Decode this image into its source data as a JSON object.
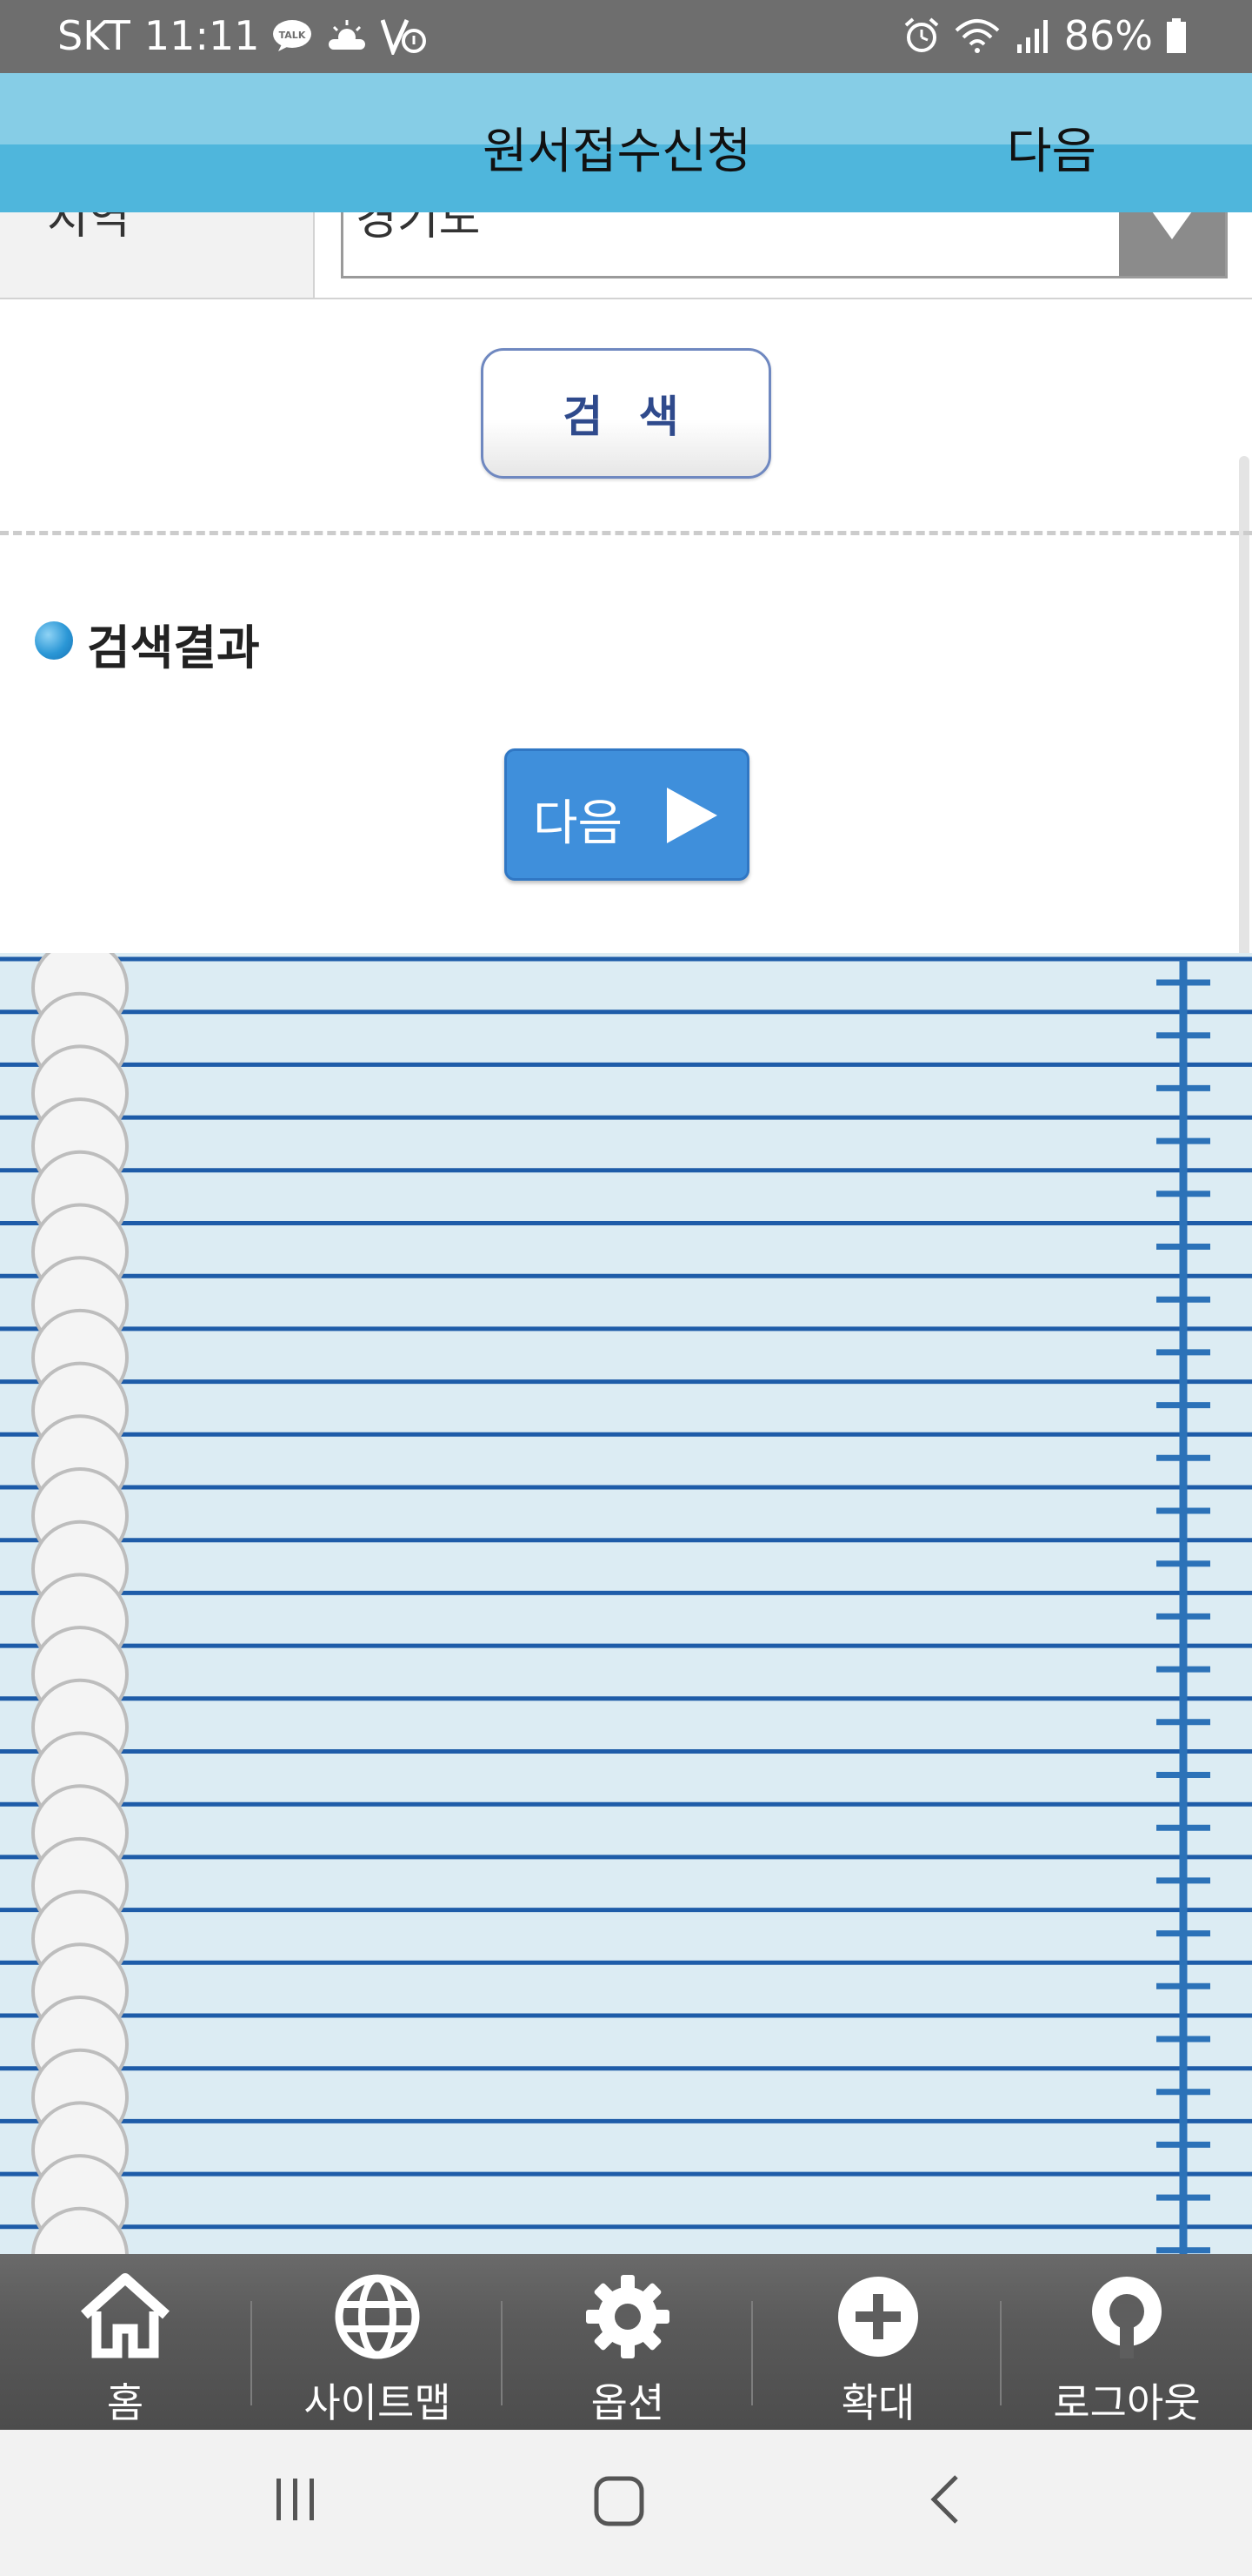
{
  "status_bar": {
    "carrier": "SKT",
    "time": "11:11",
    "battery_percent": "86%",
    "icons_left": [
      "kakaotalk-icon",
      "weather-icon",
      "v-notification-icon"
    ],
    "icons_right": [
      "alarm-icon",
      "wifi-icon",
      "signal-icon",
      "battery-icon"
    ]
  },
  "header": {
    "title": "원서접수신청",
    "next_label": "다음"
  },
  "search_form": {
    "region_label": "지역",
    "region_value": "경기도",
    "search_button_label": "검 색"
  },
  "results": {
    "title": "검색결과",
    "next_button_label": "다음"
  },
  "bottom_nav": {
    "items": [
      {
        "label": "홈",
        "icon": "home-icon"
      },
      {
        "label": "사이트맵",
        "icon": "globe-icon"
      },
      {
        "label": "옵션",
        "icon": "gear-icon"
      },
      {
        "label": "확대",
        "icon": "plus-circle-icon"
      },
      {
        "label": "로그아웃",
        "icon": "logout-icon"
      }
    ]
  },
  "system_nav": [
    "recent-apps-icon",
    "home-button-icon",
    "back-icon"
  ],
  "colors": {
    "header_top": "#86cde6",
    "header_bottom": "#4fb6dc",
    "accent_blue": "#3f8fdb",
    "notebook_bg": "#dcecf3",
    "notebook_line": "#1e5ca8"
  }
}
